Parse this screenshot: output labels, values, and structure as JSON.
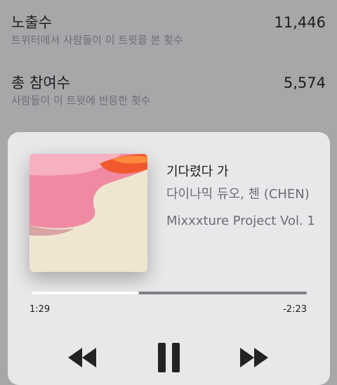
{
  "stats": {
    "impressions": {
      "title": "노출수",
      "subtitle": "트위터에서 사람들이 이 트윗을 본 횟수",
      "value": "11,446"
    },
    "engagements": {
      "title": "총 참여수",
      "subtitle": "사람들이 이 트윗에 반응한 횟수",
      "value": "5,574"
    }
  },
  "now_playing": {
    "song": "기다렸다 가",
    "artist": "다이나믹 듀오, 첸 (CHEN)",
    "album": "Mixxxture Project Vol. 1",
    "elapsed": "1:29",
    "remaining": "-2:23",
    "progress": 0.39
  },
  "icons": {
    "rewind": "rewind-icon",
    "pause": "pause-icon",
    "forward": "fast-forward-icon"
  }
}
